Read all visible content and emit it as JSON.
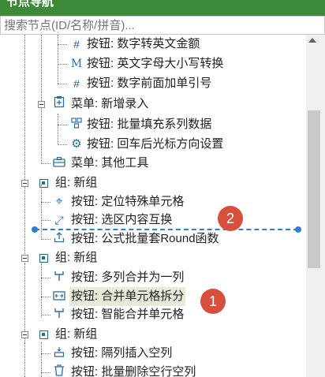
{
  "header": {
    "title": "节点导航"
  },
  "search": {
    "placeholder": "搜索节点(ID/名称/拼音)..."
  },
  "tree": [
    {
      "label": "按钮: 数字转英文金额",
      "icon": "hash-icon"
    },
    {
      "label": "按钮: 英文字母大小写转换",
      "icon": "letter-m-icon"
    },
    {
      "label": "按钮: 数字前面加单引号",
      "icon": "hash-icon"
    },
    {
      "label": "菜单: 新增录入",
      "icon": "menu-clipboard-icon"
    },
    {
      "label": "按钮: 批量填充系列数据",
      "icon": "grid-fill-icon"
    },
    {
      "label": "按钮: 回车后光标方向设置",
      "icon": "gear-icon"
    },
    {
      "label": "菜单: 其他工具",
      "icon": "toolbox-icon"
    },
    {
      "label": "组: 新组",
      "icon": "group-icon"
    },
    {
      "label": "按钮: 定位特殊单元格",
      "icon": "locate-icon"
    },
    {
      "label": "按钮: 选区内容互换",
      "icon": "swap-icon"
    },
    {
      "label": "按钮: 公式批量套Round函数",
      "icon": "upload-icon"
    },
    {
      "label": "组: 新组",
      "icon": "group-icon"
    },
    {
      "label": "按钮: 多列合并为一列",
      "icon": "merge-columns-icon"
    },
    {
      "label": "按钮: 合并单元格拆分",
      "icon": "split-cell-icon"
    },
    {
      "label": "按钮: 智能合并单元格",
      "icon": "merge-cells-icon"
    },
    {
      "label": "组: 新组",
      "icon": "group-icon"
    },
    {
      "label": "按钮: 隔列插入空列",
      "icon": "insert-column-icon"
    },
    {
      "label": "按钮: 批量删除空行空列",
      "icon": "trash-icon"
    }
  ],
  "annotations": {
    "badge1": "1",
    "badge2": "2"
  },
  "colors": {
    "header": "#3c8a38",
    "accent": "#2f7fd0",
    "badge": "#d94f3d",
    "selected": "#e4ecd9"
  }
}
